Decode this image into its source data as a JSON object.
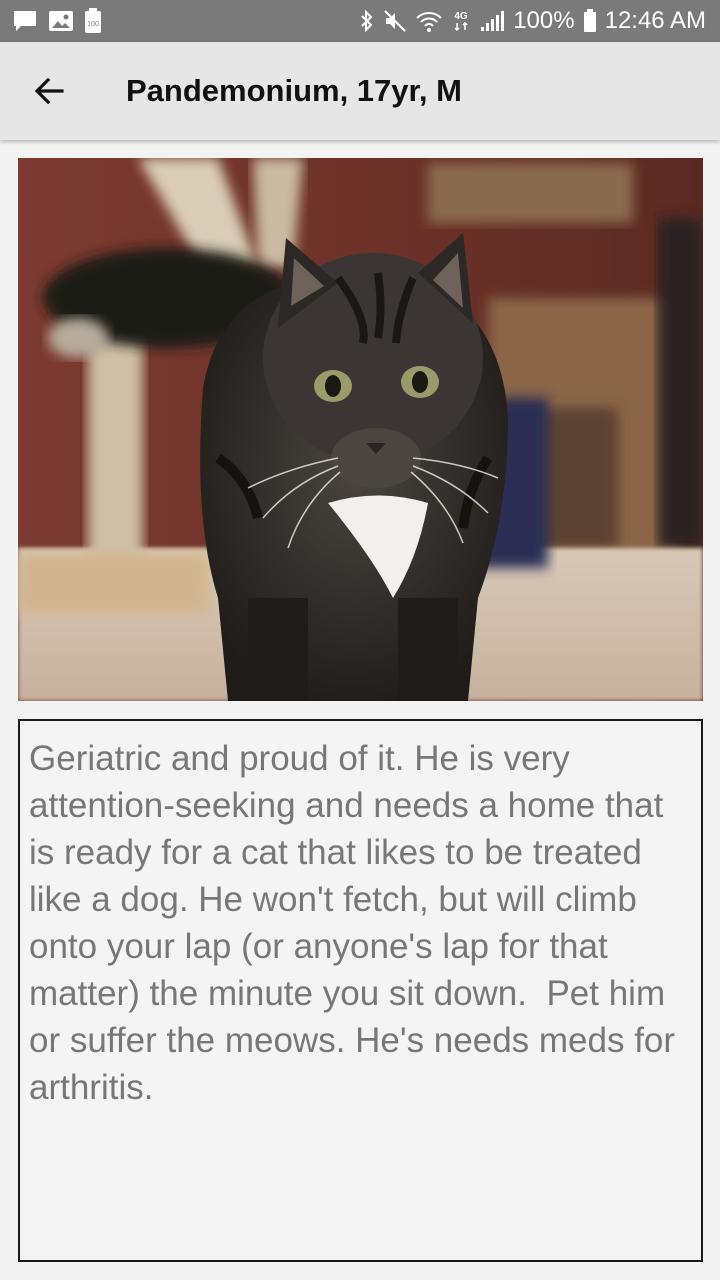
{
  "status_bar": {
    "left_icons": [
      "chat-icon",
      "image-icon",
      "battery-saver-icon"
    ],
    "battery_saver_label": "100",
    "right_icons": [
      "bluetooth-icon",
      "mute-icon",
      "wifi-icon",
      "4g-lte-icon",
      "signal-icon",
      "battery-icon"
    ],
    "network_label": "4G",
    "battery_percent": "100%",
    "time": "12:46 AM"
  },
  "app_bar": {
    "back_icon": "back-arrow-icon",
    "title": "Pandemonium, 17yr, M"
  },
  "photo": {
    "subject": "tabby cat with white chest"
  },
  "description": {
    "text": "Geriatric and proud of it. He is very attention-seeking and needs a home that is ready for a cat that likes to be treated like a dog. He won't fetch, but will climb onto your lap (or anyone's lap for that matter) the minute you sit down.  Pet him or suffer the meows. He's needs meds for arthritis."
  }
}
